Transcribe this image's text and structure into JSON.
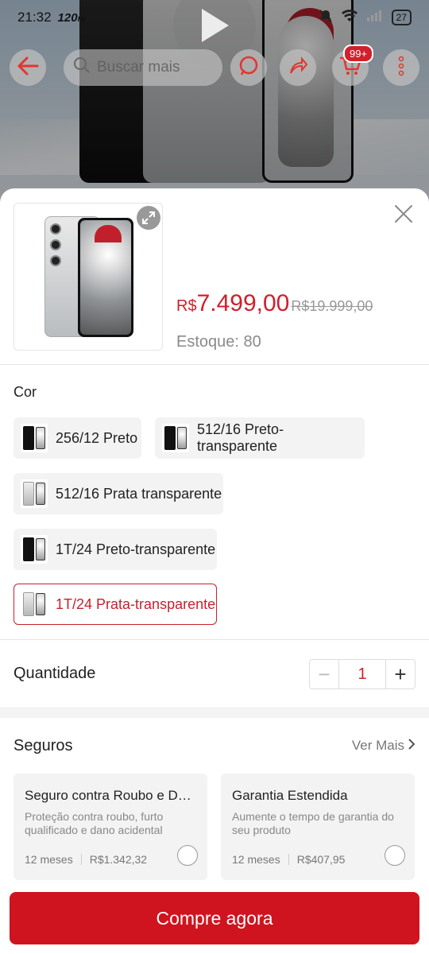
{
  "status_bar": {
    "time": "21:32",
    "refresh_rate": "120",
    "battery": "27"
  },
  "top_nav": {
    "search_placeholder": "Buscar mais",
    "cart_badge": "99+"
  },
  "product": {
    "price_currency": "R$",
    "price_value": "7.499,00",
    "old_price": "R$19.999,00",
    "stock_label": "Estoque: 80"
  },
  "color_section": {
    "label": "Cor",
    "options": [
      {
        "label": "256/12 Preto",
        "finish": "black",
        "selected": false
      },
      {
        "label": "512/16 Preto-transparente",
        "finish": "black",
        "selected": false
      },
      {
        "label": "512/16 Prata transparente",
        "finish": "silver",
        "selected": false
      },
      {
        "label": "1T/24 Preto-transparente",
        "finish": "black",
        "selected": false
      },
      {
        "label": "1T/24 Prata-transparente",
        "finish": "silver",
        "selected": true
      }
    ]
  },
  "quantity": {
    "label": "Quantidade",
    "value": "1",
    "minus": "−",
    "plus": "+"
  },
  "insurance": {
    "title": "Seguros",
    "see_more": "Ver Mais",
    "cards": [
      {
        "name": "Seguro contra Roubo e Dano Acidental",
        "desc": "Proteção contra roubo, furto qualificado e dano acidental",
        "term": "12 meses",
        "price": "R$1.342,32"
      },
      {
        "name": "Garantia Estendida",
        "desc": "Aumente o tempo de garantia do seu produto",
        "term": "12 meses",
        "price": "R$407,95"
      }
    ]
  },
  "buy_button": "Compre agora",
  "colors": {
    "accent": "#d0141f",
    "price_red": "#d0202c"
  }
}
